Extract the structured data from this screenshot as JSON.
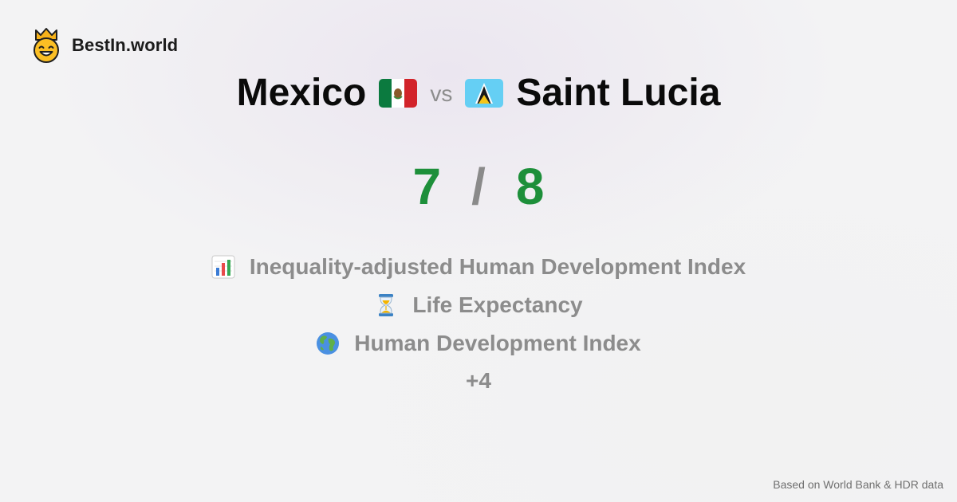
{
  "brand": {
    "name": "BestIn.world",
    "logo_icon": "crown-smiley-icon"
  },
  "comparison": {
    "left_country": "Mexico",
    "left_flag_icon": "mexico-flag-icon",
    "vs_label": "vs",
    "right_country": "Saint Lucia",
    "right_flag_icon": "saint-lucia-flag-icon"
  },
  "score": {
    "left": "7",
    "separator": "/",
    "right": "8",
    "score_color": "#1d8f3a"
  },
  "metrics": [
    {
      "icon": "bar-chart-icon",
      "label": "Inequality-adjusted Human Development Index"
    },
    {
      "icon": "hourglass-icon",
      "label": "Life Expectancy"
    },
    {
      "icon": "globe-icon",
      "label": "Human Development Index"
    }
  ],
  "more_label": "+4",
  "footer": {
    "source": "Based on World Bank & HDR data"
  }
}
